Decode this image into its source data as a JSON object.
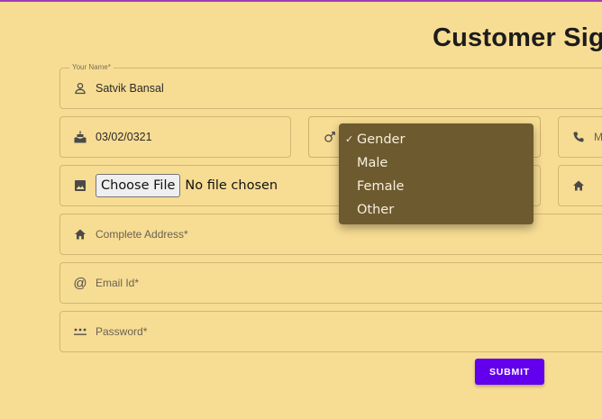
{
  "page": {
    "title": "Customer Sig"
  },
  "form": {
    "name": {
      "label": "Your Name*",
      "value": "Satvik Bansal"
    },
    "dob": {
      "value": "03/02/0321"
    },
    "phone": {
      "placeholder": "M"
    },
    "file": {
      "button_label": "Choose File",
      "status": "No file chosen"
    },
    "address": {
      "placeholder": "Complete Address*"
    },
    "email": {
      "placeholder": "Email Id*"
    },
    "password": {
      "placeholder": "Password*"
    },
    "submit_label": "SUBMIT"
  },
  "gender_dropdown": {
    "selected_mark": "✓",
    "options": [
      "Gender",
      "Male",
      "Female",
      "Other"
    ]
  },
  "colors": {
    "background": "#f7dc93",
    "accent": "#6200ee",
    "dropdown_bg": "#6e5a2f",
    "top_rule": "#a33bb8"
  }
}
